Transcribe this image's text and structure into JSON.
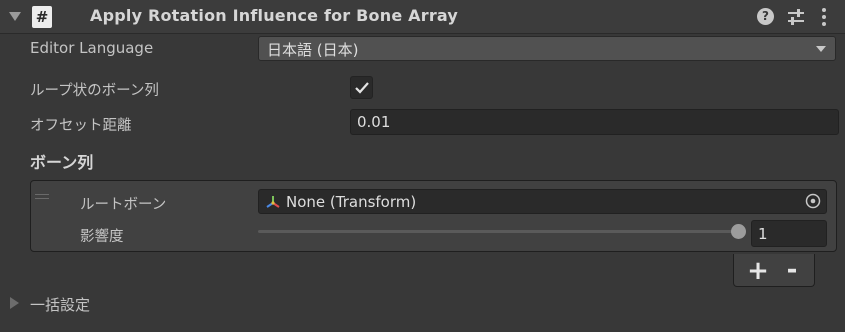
{
  "header": {
    "title": "Apply Rotation Influence for Bone Array",
    "script_icon_glyph": "#",
    "help_glyph": "?"
  },
  "rows": {
    "editor_language_label": "Editor Language",
    "editor_language_value": "日本語 (日本)",
    "loop_label": "ループ状のボーン列",
    "loop_checked": true,
    "offset_label": "オフセット距離",
    "offset_value": "0.01"
  },
  "bone_list": {
    "title": "ボーン列",
    "root_bone_label": "ルートボーン",
    "root_bone_value": "None (Transform)",
    "influence_label": "影響度",
    "influence_value": "1",
    "influence_fraction": 1.0,
    "add_glyph": "+",
    "remove_glyph": "-"
  },
  "bulk_settings": {
    "label": "一括設定",
    "expanded": false
  },
  "icons": {
    "fold": "chevron-down-icon",
    "script": "script-icon",
    "help": "help-icon",
    "preset": "preset-icon",
    "menu": "kebab-menu-icon",
    "transform": "transform-icon",
    "picker": "object-picker-icon"
  },
  "colors": {
    "background": "#383838",
    "header": "#3c3c3c",
    "field": "#2a2a2a",
    "dropdown": "#515151",
    "text": "#c4c4c4"
  }
}
